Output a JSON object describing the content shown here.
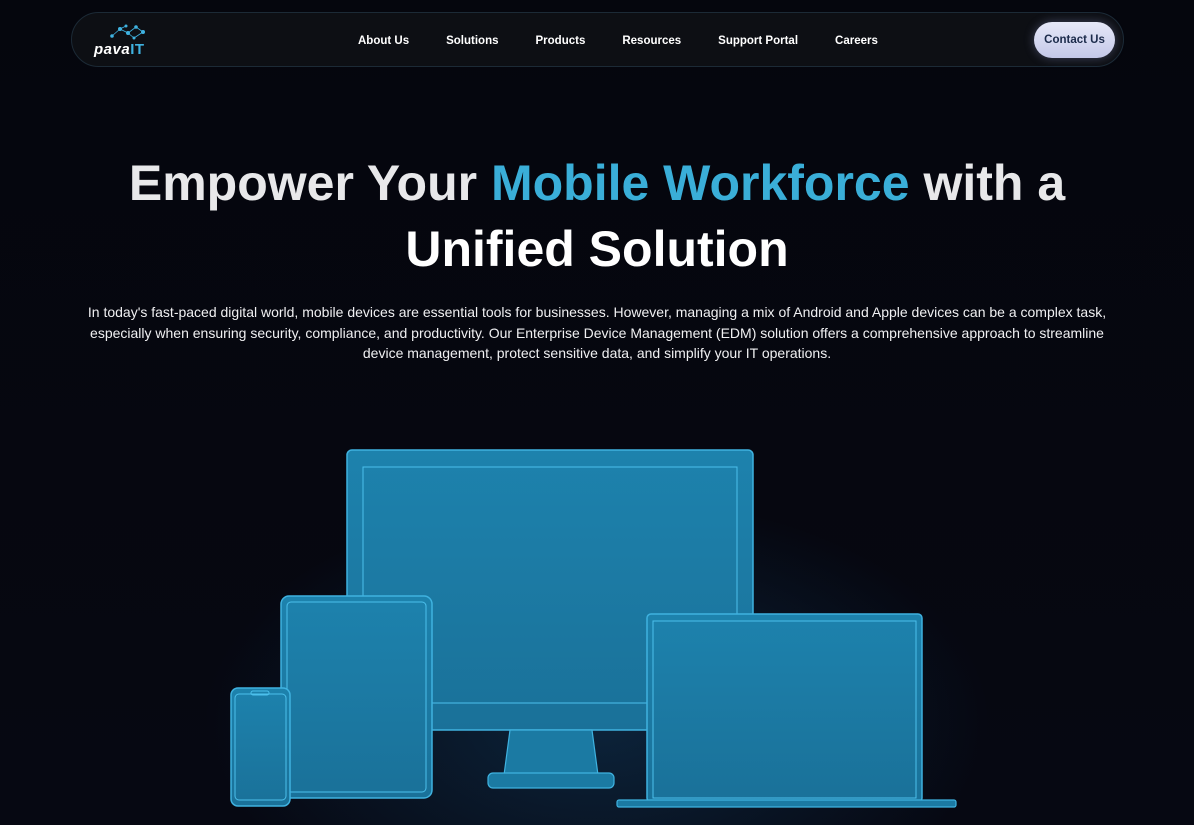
{
  "logo": {
    "brand_main": "pava",
    "brand_accent": "IT"
  },
  "nav": {
    "items": [
      {
        "label": "About Us"
      },
      {
        "label": "Solutions"
      },
      {
        "label": "Products"
      },
      {
        "label": "Resources"
      },
      {
        "label": "Support Portal"
      },
      {
        "label": "Careers"
      }
    ],
    "contact_label": "Contact Us"
  },
  "hero": {
    "title_part1": "Empower Your ",
    "title_accent": "Mobile Workforce",
    "title_part2": " with a",
    "title_line2": "Unified Solution",
    "description": "In today's fast-paced digital world, mobile devices are essential tools for businesses. However, managing a mix of Android and Apple devices can be a complex task, especially when ensuring security, compliance, and productivity. Our Enterprise Device Management (EDM) solution offers a comprehensive approach to streamline device management, protect sensitive data, and simplify your IT operations."
  },
  "colors": {
    "background": "#05060d",
    "accent": "#3aaed8",
    "device_fill": "#1b7aa3",
    "device_outline": "#3fb2e0",
    "button_bg": "#dfe2f5"
  }
}
